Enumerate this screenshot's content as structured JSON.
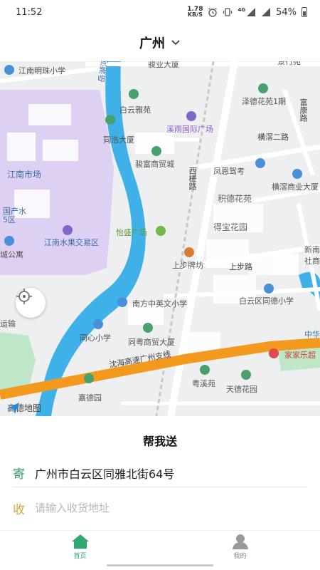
{
  "status_bar": {
    "time": "11:52",
    "net_speed_value": "1.78",
    "net_speed_unit": "KB/S",
    "network_type": "4G",
    "battery": "54%"
  },
  "header": {
    "city": "广州"
  },
  "map": {
    "labels": {
      "jiangnan_mingzhu": "江南明珠小学",
      "junye_dasha": "骏业大厦",
      "jinglin_yuan": "景行苑",
      "baiyun_ya": "白云雅苑",
      "zexin_huayuan": "泽德花苑1期",
      "fukang_road": "富康路",
      "xiyu_guoji": "溪雨国际广场",
      "tongze_dasha": "同浩大厦",
      "hengjiao_road2": "横滘二路",
      "junfu_shangmao": "骏富商贸城",
      "fengen_jiao": "凤恩驾考",
      "jiangnan_shichang": "江南市场",
      "xicha_road": "西槎路",
      "hengjiao_shangye": "横滘商业大厦",
      "jide_huayuan": "积德花苑",
      "guochan_shui": "国产水",
      "qu5": "5区",
      "debao_huayuan": "得宝花园",
      "yisheng_guangchang": "怡盛广场",
      "jiangnan_shuiguo": "江南水果交易区",
      "cheng_gongyu": "城公寓",
      "xinnan_she": "新南社商",
      "shangbu_paifang": "上步牌坊",
      "shangbu_road": "上步路",
      "baiyun_tongde": "白云区同德小学",
      "nanfang_zhongying": "南方中英文小学",
      "yunshu": "运输",
      "tongxin_xiaoxue": "同心小学",
      "zhonghua": "中华",
      "tongyue_shangmao": "同粤商贸大厦",
      "jialele": "家家乐超",
      "shenhai_gaosu": "沈海高速广州支线",
      "yuexi_yuan": "粤溪苑",
      "tiande_huayuan": "天德花园",
      "jiade_yuan": "嘉德园",
      "yuehe": "岳湖河"
    },
    "logo_text": "高德地图"
  },
  "panel": {
    "title": "帮我送",
    "send_tag": "寄",
    "send_address": "广州市白云区同雅北街64号",
    "recv_tag": "收",
    "recv_placeholder": "请输入收货地址"
  },
  "tabbar": {
    "home_label": "首页",
    "mine_label": "我的"
  },
  "colors": {
    "accent_green": "#2eaa6e",
    "recv_orange": "#e0a63a",
    "highway_orange": "#f39a1e",
    "river_blue": "#3fb0e8"
  }
}
